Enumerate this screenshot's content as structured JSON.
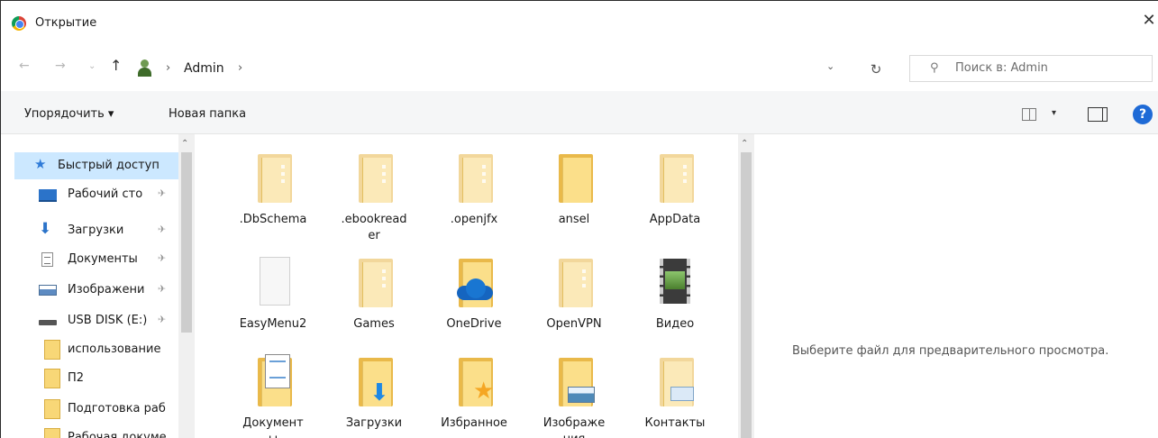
{
  "window": {
    "title": "Открытие",
    "close_label": "✕"
  },
  "nav": {
    "back": "←",
    "forward": "→",
    "recent": "⌄",
    "up": "↑",
    "crumb_sep": "›",
    "crumbs": [
      "Admin"
    ],
    "address_dropdown": "⌄",
    "refresh": "↻",
    "search_placeholder": "Поиск в: Admin"
  },
  "toolbar": {
    "organize": "Упорядочить ▾",
    "new_folder": "Новая папка",
    "view_dropdown": "▾",
    "help": "?"
  },
  "sidebar": {
    "items": [
      {
        "label": "Быстрый доступ",
        "icon": "quick-access-star-icon",
        "pinned": false
      },
      {
        "label": "Рабочий сто",
        "icon": "desktop-icon",
        "pinned": true
      },
      {
        "label": "Загрузки",
        "icon": "downloads-icon",
        "pinned": true
      },
      {
        "label": "Документы",
        "icon": "documents-icon",
        "pinned": true
      },
      {
        "label": "Изображени",
        "icon": "pictures-icon",
        "pinned": true
      },
      {
        "label": "USB DISK (E:)",
        "icon": "usb-drive-icon",
        "pinned": true
      },
      {
        "label": "использование",
        "icon": "folder-icon",
        "pinned": false
      },
      {
        "label": "П2",
        "icon": "folder-icon",
        "pinned": false
      },
      {
        "label": "Подготовка раб",
        "icon": "folder-icon",
        "pinned": false
      },
      {
        "label": "Рабочая докуме",
        "icon": "folder-icon",
        "pinned": false
      }
    ],
    "pin_glyph": "✈"
  },
  "files": [
    {
      "name": ".DbSchema"
    },
    {
      "name": ".ebookreader"
    },
    {
      "name": ".openjfx"
    },
    {
      "name": "ansel"
    },
    {
      "name": "AppData"
    },
    {
      "name": "EasyMenu2"
    },
    {
      "name": "Games"
    },
    {
      "name": "OneDrive"
    },
    {
      "name": "OpenVPN"
    },
    {
      "name": "Видео"
    },
    {
      "name": "Документы"
    },
    {
      "name": "Загрузки"
    },
    {
      "name": "Избранное"
    },
    {
      "name": "Изображения"
    },
    {
      "name": "Контакты"
    }
  ],
  "file_labels_display": [
    ".DbSchema",
    ".ebookread\ner",
    ".openjfx",
    "ansel",
    "AppData",
    "EasyMenu2",
    "Games",
    "OneDrive",
    "OpenVPN",
    "Видео",
    "Документ\nы",
    "Загрузки",
    "Избранное",
    "Изображе\nния",
    "Контакты"
  ],
  "preview": {
    "message": "Выберите файл для предварительного просмотра."
  },
  "colors": {
    "selected_bg": "#cce8ff",
    "folder": "#fbdf8a",
    "accent": "#1e6ad6"
  }
}
